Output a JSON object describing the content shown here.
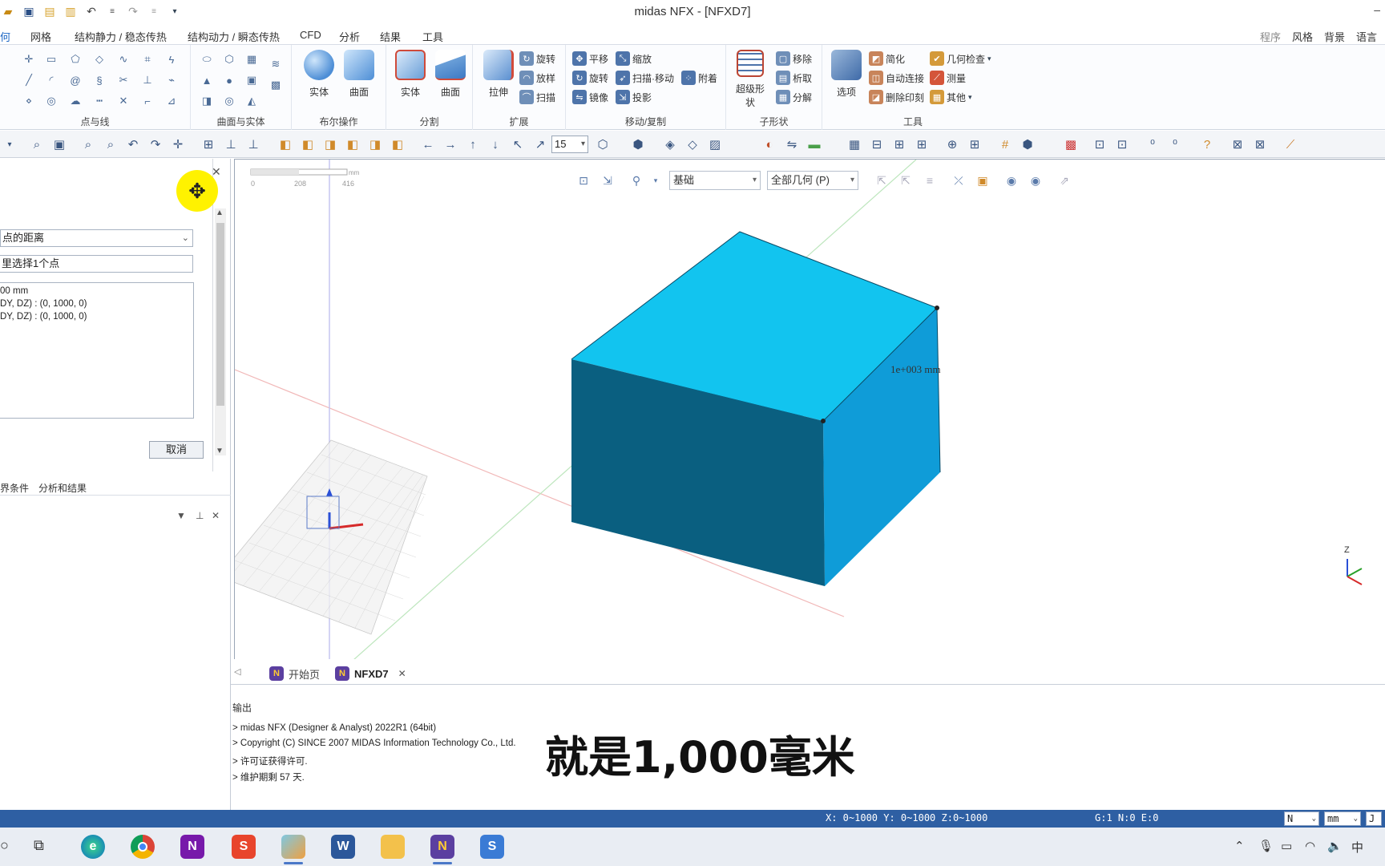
{
  "window": {
    "title": "midas NFX - [NFXD7]"
  },
  "menu": {
    "tabs": [
      {
        "label": "何"
      },
      {
        "label": "网格"
      },
      {
        "label": "结构静力 / 稳态传热"
      },
      {
        "label": "结构动力 / 瞬态传热"
      },
      {
        "label": "CFD"
      },
      {
        "label": "分析"
      },
      {
        "label": "结果"
      },
      {
        "label": "工具"
      }
    ],
    "right": [
      "程序",
      "风格",
      "背景",
      "语言"
    ]
  },
  "ribbon": {
    "groups": {
      "points_lines": "点与线",
      "surface_solid": "曲面与实体",
      "boolean": "布尔操作",
      "divide": "分割",
      "extend": "扩展",
      "move_copy": "移动/复制",
      "subshape": "子形状",
      "tools": "工具"
    },
    "big_buttons": {
      "bool_solid": "实体",
      "bool_surface": "曲面",
      "div_solid": "实体",
      "div_surface": "曲面",
      "extrude": "拉伸",
      "super_shape": "超级形状",
      "options": "选项"
    },
    "small_buttons": {
      "revolve": "旋转",
      "loft": "放样",
      "sweep": "扫描",
      "translate": "平移",
      "scale": "缩放",
      "rotate": "旋转",
      "sweep_move": "扫描·移动",
      "attach": "附着",
      "mirror": "镜像",
      "project": "投影",
      "remove": "移除",
      "extract": "析取",
      "decompose": "分解",
      "simplify": "简化",
      "auto_connect": "自动连接",
      "delete_imprint": "删除印刻",
      "geo_check": "几何检查",
      "measure": "测量",
      "others": "其他"
    }
  },
  "toolbar2": {
    "zoom_value": "15"
  },
  "dialog": {
    "measure_type": "点的距离",
    "prompt": "里选择1个点",
    "results": [
      "00 mm",
      "DY, DZ) : (0, 1000, 0)",
      "DY, DZ) : (0, 1000, 0)"
    ],
    "cancel_label": "取消"
  },
  "panel_tabs": [
    "界条件",
    "分析和结果"
  ],
  "viewport": {
    "filter_select": "基础",
    "geometry_select": "全部几何 (P)",
    "ruler_ticks": [
      "0",
      "208",
      "416"
    ],
    "ruler_unit": "mm",
    "dimension_label": "1e+003  mm",
    "axis_label": "Z"
  },
  "doc_tabs": [
    {
      "label": "开始页"
    },
    {
      "label": "NFXD7"
    }
  ],
  "output": {
    "title": "输出",
    "lines": [
      "> midas NFX (Designer & Analyst) 2022R1 (64bit)",
      "> Copyright (C) SINCE 2007 MIDAS Information Technology Co., Ltd.",
      "> 许可证获得许可.",
      "> 维护期剩 57 天."
    ]
  },
  "subtitle": "就是1,000毫米",
  "status": {
    "coords": "X: 0~1000 Y: 0~1000 Z:0~1000",
    "counts": "G:1  N:0  E:0",
    "force_unit": "N",
    "length_unit": "mm",
    "extra": "J"
  },
  "colors": {
    "cube_top": "#12c4ef",
    "cube_front": "#0a5f80",
    "cube_right": "#0f9cd8",
    "status_bar": "#2e5fa3",
    "highlight": "#fff200"
  }
}
